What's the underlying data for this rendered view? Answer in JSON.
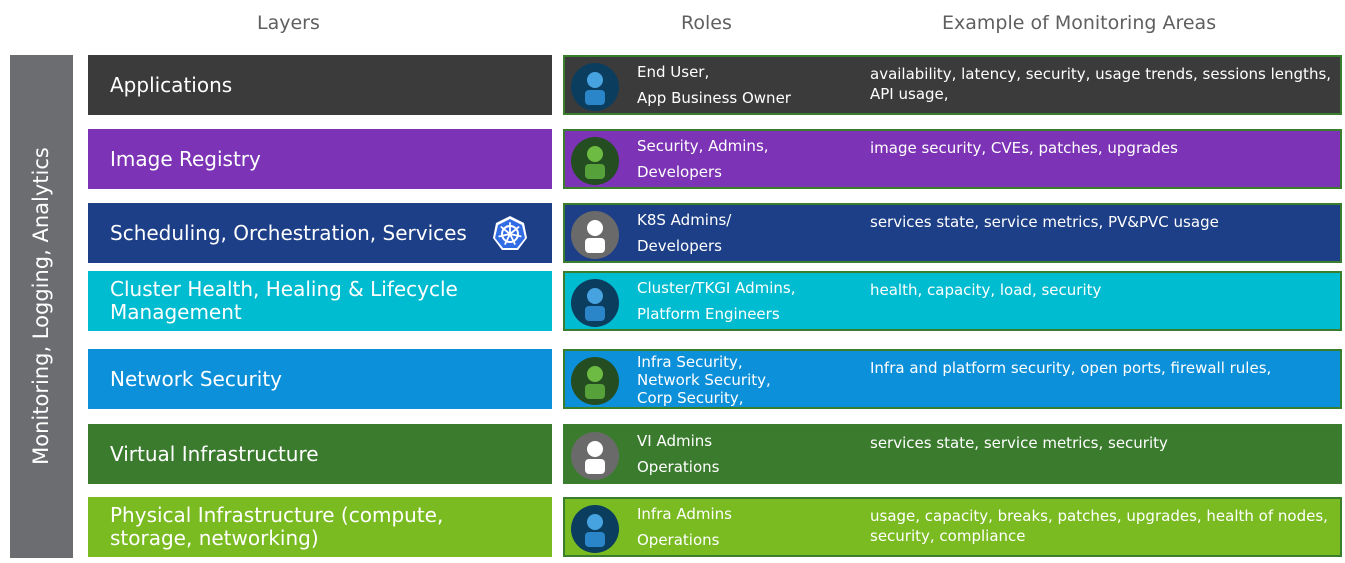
{
  "headers": {
    "layers": "Layers",
    "roles": "Roles",
    "areas": "Example of Monitoring Areas"
  },
  "side_label": "Monitoring, Logging, Analytics",
  "rows": [
    {
      "layer": "Applications",
      "layer_color": "#3b3b3b",
      "card_color": "#3b3b3b",
      "avatar": "blue",
      "roles": [
        "End User,",
        "App Business Owner"
      ],
      "areas": "availability, latency, security, usage trends, sessions lengths, API usage,"
    },
    {
      "layer": "Image Registry",
      "layer_color": "#7d33b5",
      "card_color": "#7d33b5",
      "avatar": "green",
      "roles": [
        "Security, Admins,",
        "Developers"
      ],
      "areas": "image security, CVEs, patches, upgrades"
    },
    {
      "layer": "Scheduling, Orchestration, Services",
      "layer_color": "#1d3f87",
      "card_color": "#1d3f87",
      "avatar": "grey",
      "roles": [
        "K8S Admins/",
        "Developers"
      ],
      "areas": "services state, service metrics, PV&PVC usage",
      "icon": "kubernetes-icon"
    },
    {
      "layer": "Cluster Health, Healing & Lifecycle Management",
      "layer_color": "#00bcd0",
      "card_color": "#00bcd0",
      "avatar": "blue",
      "roles": [
        "Cluster/TKGI Admins,",
        "Platform Engineers"
      ],
      "areas": "health, capacity, load, security"
    },
    {
      "layer": "Network Security",
      "layer_color": "#0d90da",
      "card_color": "#0d90da",
      "avatar": "green",
      "roles": [
        "Infra Security,",
        "Network Security,",
        "Corp Security,"
      ],
      "areas": "Infra and platform security, open ports, firewall rules,"
    },
    {
      "layer": "Virtual Infrastructure",
      "layer_color": "#3b7b2d",
      "card_color": "#3b7b2d",
      "avatar": "grey",
      "roles": [
        "VI Admins",
        "Operations"
      ],
      "areas": "services state, service metrics, security"
    },
    {
      "layer": "Physical Infrastructure (compute, storage, networking)",
      "layer_color": "#79bb21",
      "card_color": "#79bb21",
      "avatar": "blue",
      "roles": [
        "Infra Admins",
        "Operations"
      ],
      "areas": "usage, capacity, breaks, patches, upgrades, health of nodes, security, compliance"
    }
  ]
}
